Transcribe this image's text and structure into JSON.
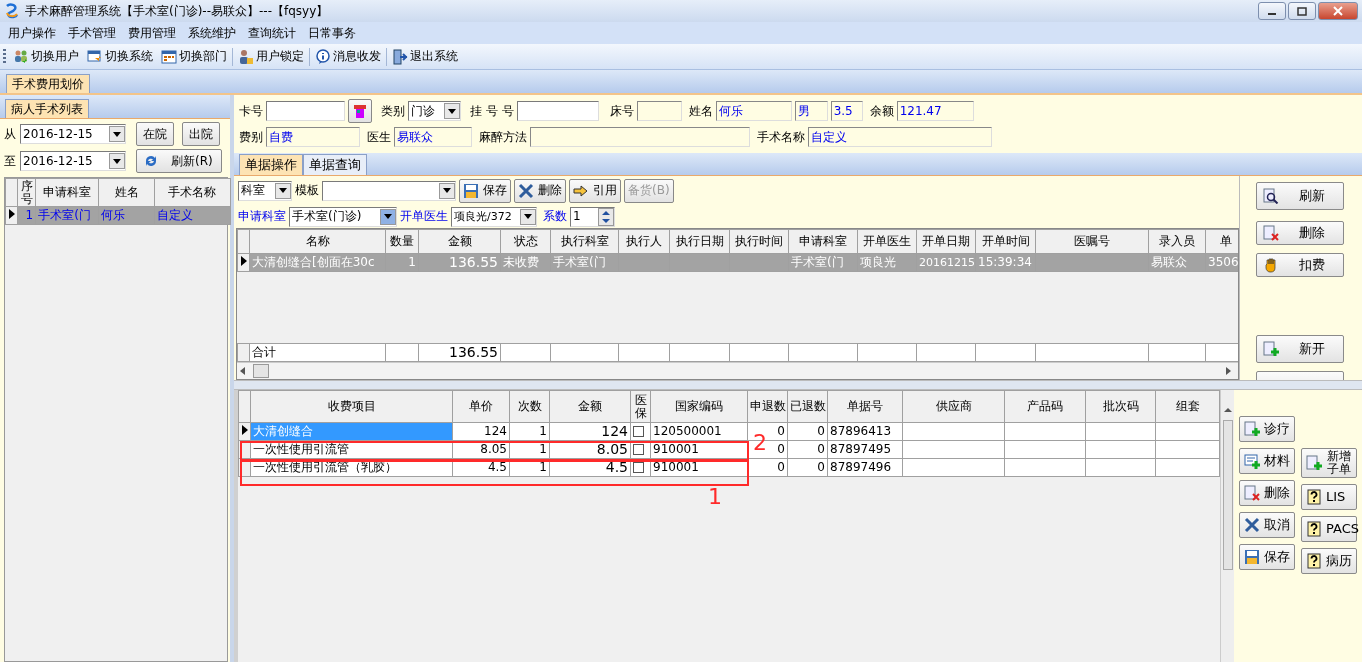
{
  "window": {
    "title": "手术麻醉管理系统【手术室(门诊)--易联众】---【fqsyy】"
  },
  "menu": [
    "用户操作",
    "手术管理",
    "费用管理",
    "系统维护",
    "查询统计",
    "日常事务"
  ],
  "toolbar": [
    [
      "切换用户",
      "切换系统",
      "切换部门"
    ],
    [
      "用户锁定"
    ],
    [
      "消息收发"
    ],
    [
      "退出系统"
    ]
  ],
  "main_tabs": [
    {
      "label": "手术费用划价",
      "selected": true
    }
  ],
  "patient_panel": {
    "title": "病人手术列表",
    "from_label": "从",
    "from_date": "2016-12-15",
    "to_label": "至",
    "to_date": "2016-12-15",
    "buttons": [
      "在院",
      "出院"
    ],
    "refresh_button": "刷新(R)",
    "columns": [
      "序号",
      "申请科室",
      "姓名",
      "手术名称"
    ],
    "rows": [
      {
        "cells": [
          "1",
          "手术室(门",
          "何乐",
          "自定义"
        ],
        "selected": true
      }
    ]
  },
  "patient_form": {
    "card_label": "卡号",
    "category_label": "类别",
    "category": "门诊",
    "reg_label": "挂 号 号",
    "bed_label": "床号",
    "name_label": "姓名",
    "name": "何乐",
    "sex": "男",
    "age": "3.5",
    "balance_label": "余额",
    "balance": "121.47",
    "fee_type_label": "费别",
    "fee_type": "自费",
    "doctor_label": "医生",
    "doctor": "易联众",
    "anesthesia_label": "麻醉方法",
    "surgery_label": "手术名称",
    "surgery": "自定义"
  },
  "doc_tabs": [
    {
      "label": "单据操作",
      "selected": true
    },
    {
      "label": "单据查询",
      "selected": false
    }
  ],
  "order_toolbar": {
    "dept_select": "科室",
    "template_label": "模板",
    "buttons": [
      {
        "label": "保存",
        "disabled": false
      },
      {
        "label": "删除",
        "disabled": false
      },
      {
        "label": "引用",
        "disabled": false
      },
      {
        "label": "备货(B)",
        "disabled": true
      }
    ]
  },
  "order_filter": {
    "dept_label": "申请科室",
    "dept": "手术室(门诊)",
    "doctor_label": "开单医生",
    "doctor": "项良光/372",
    "coef_label": "系数",
    "coef": "1"
  },
  "orders": {
    "columns": [
      "名称",
      "数量",
      "金额",
      "状态",
      "执行科室",
      "执行人",
      "执行日期",
      "执行时间",
      "申请科室",
      "开单医生",
      "开单日期",
      "开单时间",
      "医嘱号",
      "录入员",
      "单"
    ],
    "rows": [
      {
        "cells": [
          "大清创缝合[创面在30c",
          "1",
          "136.55",
          "未收费",
          "手术室(门",
          null,
          null,
          null,
          "手术室(门",
          "项良光",
          "20161215",
          "15:39:34",
          null,
          "易联众",
          "3506"
        ],
        "selected": true
      }
    ],
    "total_label": "合计",
    "total": "136.55"
  },
  "order_buttons": [
    "刷新",
    "删除",
    "扣费",
    "新开"
  ],
  "items": {
    "columns": [
      "收费项目",
      "单价",
      "次数",
      "金额",
      "医保",
      "国家编码",
      "申退数",
      "已退数",
      "单据号",
      "供应商",
      "产品码",
      "批次码",
      "组套"
    ],
    "rows": [
      {
        "name": "大清创缝合",
        "price": "124",
        "count": "1",
        "amount": "124",
        "insured": false,
        "code": "120500001",
        "req_refund": "0",
        "refunded": "0",
        "doc_no": "87896413",
        "selected": true
      },
      {
        "name": "一次性使用引流管",
        "price": "8.05",
        "count": "1",
        "amount": "8.05",
        "insured": false,
        "code": "910001",
        "req_refund": "0",
        "refunded": "0",
        "doc_no": "87897495",
        "selected": false
      },
      {
        "name": "一次性使用引流管（乳胶）",
        "price": "4.5",
        "count": "1",
        "amount": "4.5",
        "insured": false,
        "code": "910001",
        "req_refund": "0",
        "refunded": "0",
        "doc_no": "87897496",
        "selected": false
      }
    ]
  },
  "annotations": [
    "2",
    "1"
  ],
  "item_buttons_left": [
    "诊疗",
    "材料",
    "删除",
    "取消",
    "保存"
  ],
  "item_buttons_right": [
    "新增子单",
    "LIS",
    "PACS",
    "病历"
  ]
}
